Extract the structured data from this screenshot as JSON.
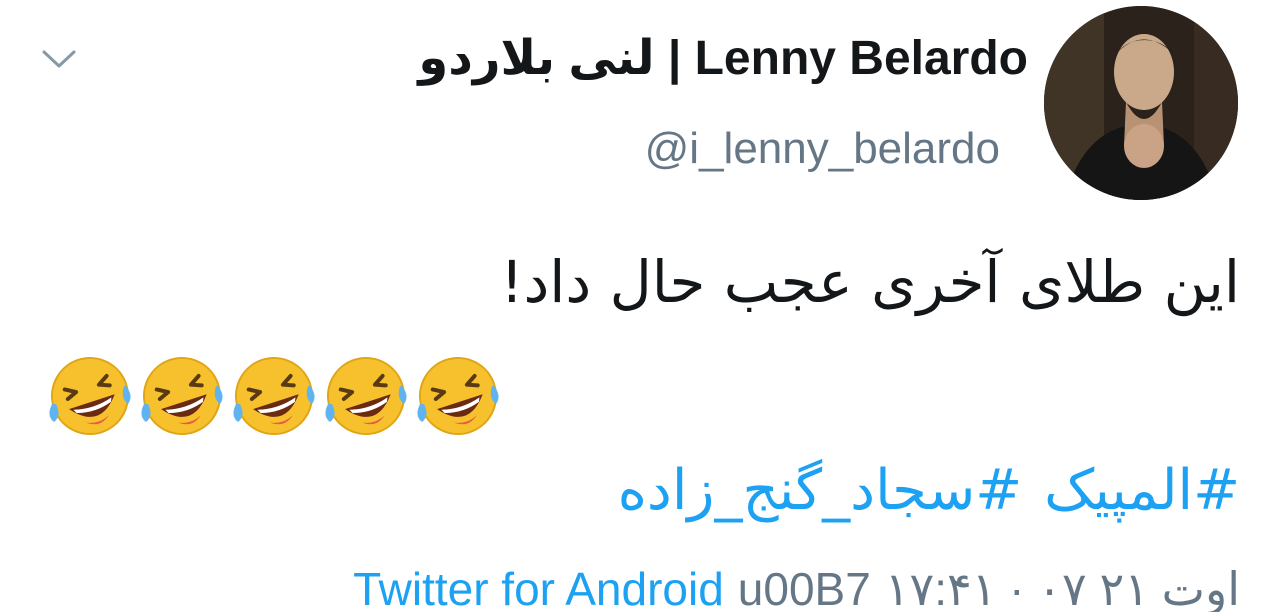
{
  "header": {
    "display_name": "لنی بلاردو | Lenny Belardo",
    "handle": "@i_lenny_belardo"
  },
  "tweet": {
    "text": "این طلای آخری عجب حال داد!",
    "emoji_count": 5,
    "emoji_name": "rolling-on-the-floor-laughing",
    "hashtags": [
      "#المپیک",
      "#سجاد_گنج_زاده"
    ]
  },
  "meta": {
    "timestamp": "۱۷:۴۱ · ۰۷ اوت ۲۱",
    "separator": "u00B7",
    "source": "Twitter for Android"
  },
  "colors": {
    "link": "#1da1f2",
    "secondary": "#657786",
    "primary_text": "#14171a"
  }
}
